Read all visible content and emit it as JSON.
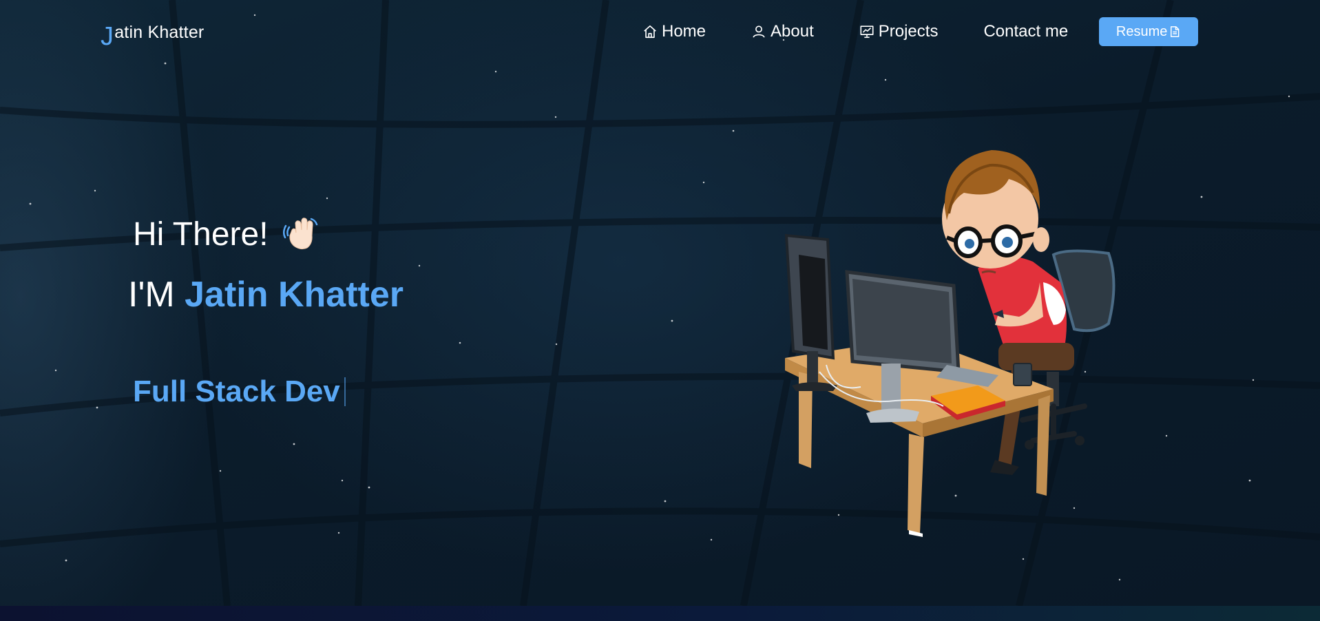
{
  "brand": {
    "initial": "J",
    "rest": "atin Khatter"
  },
  "nav": {
    "items": [
      {
        "label": "Home",
        "icon": "home-icon"
      },
      {
        "label": "About",
        "icon": "user-icon"
      },
      {
        "label": "Projects",
        "icon": "presentation-icon"
      },
      {
        "label": "Contact me",
        "icon": ""
      }
    ],
    "resume_label": "Resume",
    "resume_icon": "document-icon"
  },
  "hero": {
    "greeting": "Hi There!",
    "wave_icon": "waving-hand-icon",
    "intro_prefix": "I'M ",
    "name": "Jatin Khatter",
    "typed_role": "Full Stack Dev"
  },
  "colors": {
    "accent": "#5aa8f5",
    "background": "#0c1d2c",
    "text": "#ffffff"
  }
}
